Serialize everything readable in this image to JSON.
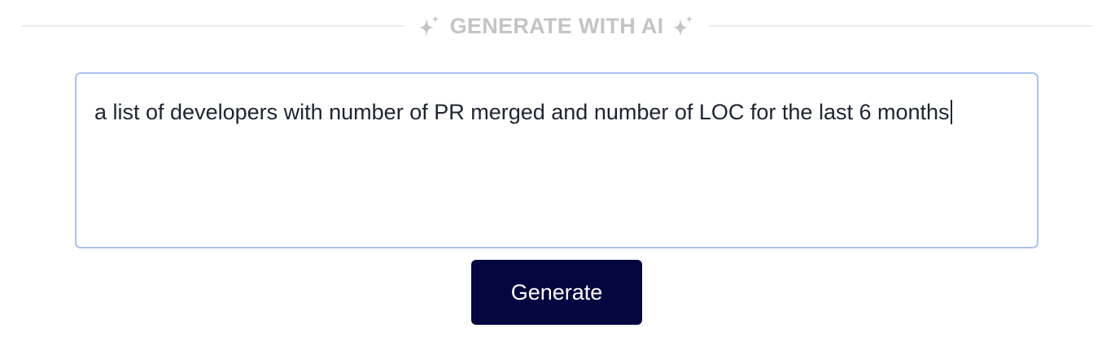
{
  "header": {
    "title": "GENERATE WITH AI",
    "left_icon": "sparkle-icon",
    "right_icon": "sparkle-icon"
  },
  "prompt": {
    "value": "a list of developers with number of PR merged and number of LOC for the last 6 months",
    "focused": true
  },
  "actions": {
    "generate_label": "Generate"
  },
  "colors": {
    "header_text": "#c4c4c4",
    "divider": "#ececec",
    "input_border": "#a9c1f2",
    "input_text": "#1f2430",
    "button_bg": "#050540",
    "button_text": "#ffffff"
  }
}
